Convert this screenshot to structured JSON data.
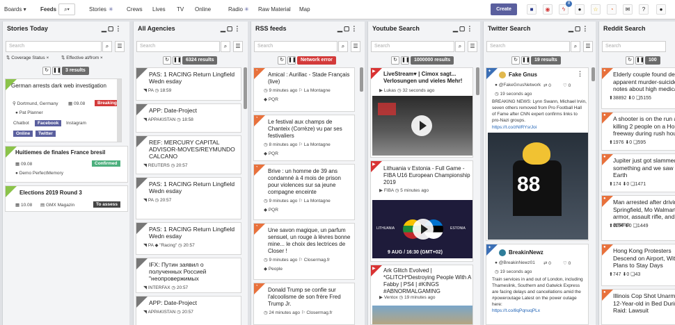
{
  "topbar": {
    "boards": "Boards",
    "feeds": "Feeds",
    "links": [
      "Stories",
      "Crews",
      "Lives",
      "TV",
      "Online",
      "Radio",
      "Raw Material",
      "Map"
    ],
    "create": "Create",
    "notif_count": "8"
  },
  "columns": [
    {
      "title": "Stories Today"
    },
    {
      "title": "All Agencies",
      "results": "6324 results"
    },
    {
      "title": "RSS feeds",
      "results": "Network error"
    },
    {
      "title": "Youtube Search",
      "results": "1000000 results"
    },
    {
      "title": "Twitter Search",
      "results": "19 results"
    },
    {
      "title": "Reddit Search",
      "results": "100"
    }
  ],
  "search_placeholder": "Search",
  "stories": {
    "filters": [
      "Coverage Status",
      "Effective at/from"
    ],
    "results": "3 results",
    "cards": [
      {
        "title": "German arrests dark web investigation",
        "place": "Dortmund, Germany",
        "date": "09.08",
        "status": "Breaking",
        "person": "Pat Planner",
        "channels": [
          "Chatbot",
          "Facebook",
          "Instagram",
          "Online",
          "Twitter"
        ]
      },
      {
        "title": "Huitiemes de finales France bresil",
        "date": "09.08",
        "status": "Confirmed",
        "person": "Demo PerfectMemory"
      },
      {
        "title": "Elections 2019 Round 3",
        "date": "10.08",
        "source": "GMX Magazin",
        "status": "To assess"
      }
    ]
  },
  "agencies": [
    {
      "title": "PAS: 1 RACING Return Lingfield Wedn esday",
      "src": "PA",
      "time": "18:59"
    },
    {
      "title": "APP: Date-Project",
      "src": "APPAKISTAN",
      "time": "18:58"
    },
    {
      "title": "REF: MERCURY CAPITAL ADVISOR-MOVES/REYMUNDO CALCANO",
      "src": "REUTERS",
      "time": "20:57"
    },
    {
      "title": "PAS: 1 RACING Return Lingfield Wedn esday",
      "src": "PA",
      "time": "20:57"
    },
    {
      "title": "PAS: 1 RACING Return Lingfield Wedn esday",
      "src": "PA",
      "tag": "\"Racing\"",
      "time": "20:57"
    },
    {
      "title": "IFX: Путин заявил о полученных Россией \"неопровержимых",
      "src": "INTERFAX",
      "time": "20:57"
    },
    {
      "title": "APP: Date-Project",
      "src": "APPAKISTAN",
      "time": "20:57"
    }
  ],
  "rss": [
    {
      "title": "Amical : Aurillac - Stade Français (live)",
      "time": "9 minutes ago",
      "src": "La Montagne",
      "tag": "PQR"
    },
    {
      "title": "Le festival aux champs de Chanteix (Corrèze) vu par ses festivaliers",
      "time": "8 minutes ago",
      "src": "La Montagne",
      "tag": "PQR"
    },
    {
      "title": "Brive : un homme de 39 ans condamné à 4 mois de prison pour violences sur sa jeune compagne enceinte",
      "time": "9 minutes ago",
      "src": "La Montagne",
      "tag": "PQR"
    },
    {
      "title": "Une savon magique, un parfum sensuel, un rouge à lèvres bonne mine... le choix des lectrices de Closer !",
      "time": "9 minutes ago",
      "src": "Closermag.fr",
      "tag": "People"
    },
    {
      "title": "Donald Trump se confie sur l'alcoolisme de son frère Fred Trump Jr.",
      "time": "24 minutes ago",
      "src": "Closermag.fr"
    }
  ],
  "youtube": [
    {
      "title": "LiveStream♥ | Cimox sagt... Verlosungen und vieles Mehr!",
      "src": "Lukas",
      "time": "32 seconds ago"
    },
    {
      "title": "Lithuania v Estonia - Full Game - FIBA U16 European Championship 2019",
      "src": "FIBA",
      "time": "5 minutes ago",
      "img_caption": "9 AUG / 16:30 (GMT+02)",
      "teams": [
        "LITHUANIA",
        "ESTONIA"
      ]
    },
    {
      "title": "Ark Glitch Evolved | *GLITCH*Destroying People With A Fabby | PS4 | #KINGS #ABNORMALGAMING",
      "src": "Ventox",
      "time": "19 minutes ago"
    }
  ],
  "twitter": [
    {
      "name": "Fake Gnus",
      "handle": "@FakeGnusNetwork",
      "rt": "0",
      "likes": "0",
      "time": "19 seconds ago",
      "text": "BREAKING NEWS: Lynn Swann, Michael Irvin, seven others removed from Pro Football Hall of Fame after CNN expert confirms links to pro-Nazi groups.",
      "link": "https://t.co/zNIRYsrJoi",
      "jersey": "88"
    },
    {
      "name": "BreakinNewz",
      "handle": "@BreakinNewz01",
      "rt": "0",
      "likes": "0",
      "time": "19 seconds ago",
      "text": "Train services in and out of London, including Thameslink, Southern and Gatwick Express are facing delays and cancellations amid the #poweroutage Latest on the power outage here:",
      "link": "https://t.co/8qPqnuqPLx"
    }
  ],
  "reddit": [
    {
      "title": "Elderly couple found dead apparent murder-suicide, notes about high medical",
      "up": "38892",
      "down": "0",
      "com": "5155"
    },
    {
      "title": "A shooter is on the run after killing 2 people on a House freeway during rush hour",
      "up": "1976",
      "down": "0",
      "com": "595"
    },
    {
      "title": "Jupiter just got slammed by something and we saw it Earth",
      "up": "174",
      "down": "0",
      "com": "1471"
    },
    {
      "title": "Man arrested after driving Springfield, Mo Walmart with armor, assault rifle, and 1 of ammo",
      "up": "1154",
      "down": "0",
      "com": "1449"
    },
    {
      "title": "Hong Kong Protesters Descend on Airport, With Plans to Stay Days",
      "up": "747",
      "down": "0",
      "com": "43"
    },
    {
      "title": "Illinois Cop Shot Unarmed 12-Year-old in Bed During Raid: Lawsuit",
      "up": "",
      "down": "",
      "com": ""
    }
  ],
  "colors": {
    "accent": "#5a5f9e",
    "rss": "#e8713c",
    "youtube": "#d93333",
    "twitter": "#3b6fb6",
    "reddit": "#e8713c",
    "story": "#8bc34a",
    "breaking": "#d33a3a",
    "confirmed": "#4caf7d"
  }
}
